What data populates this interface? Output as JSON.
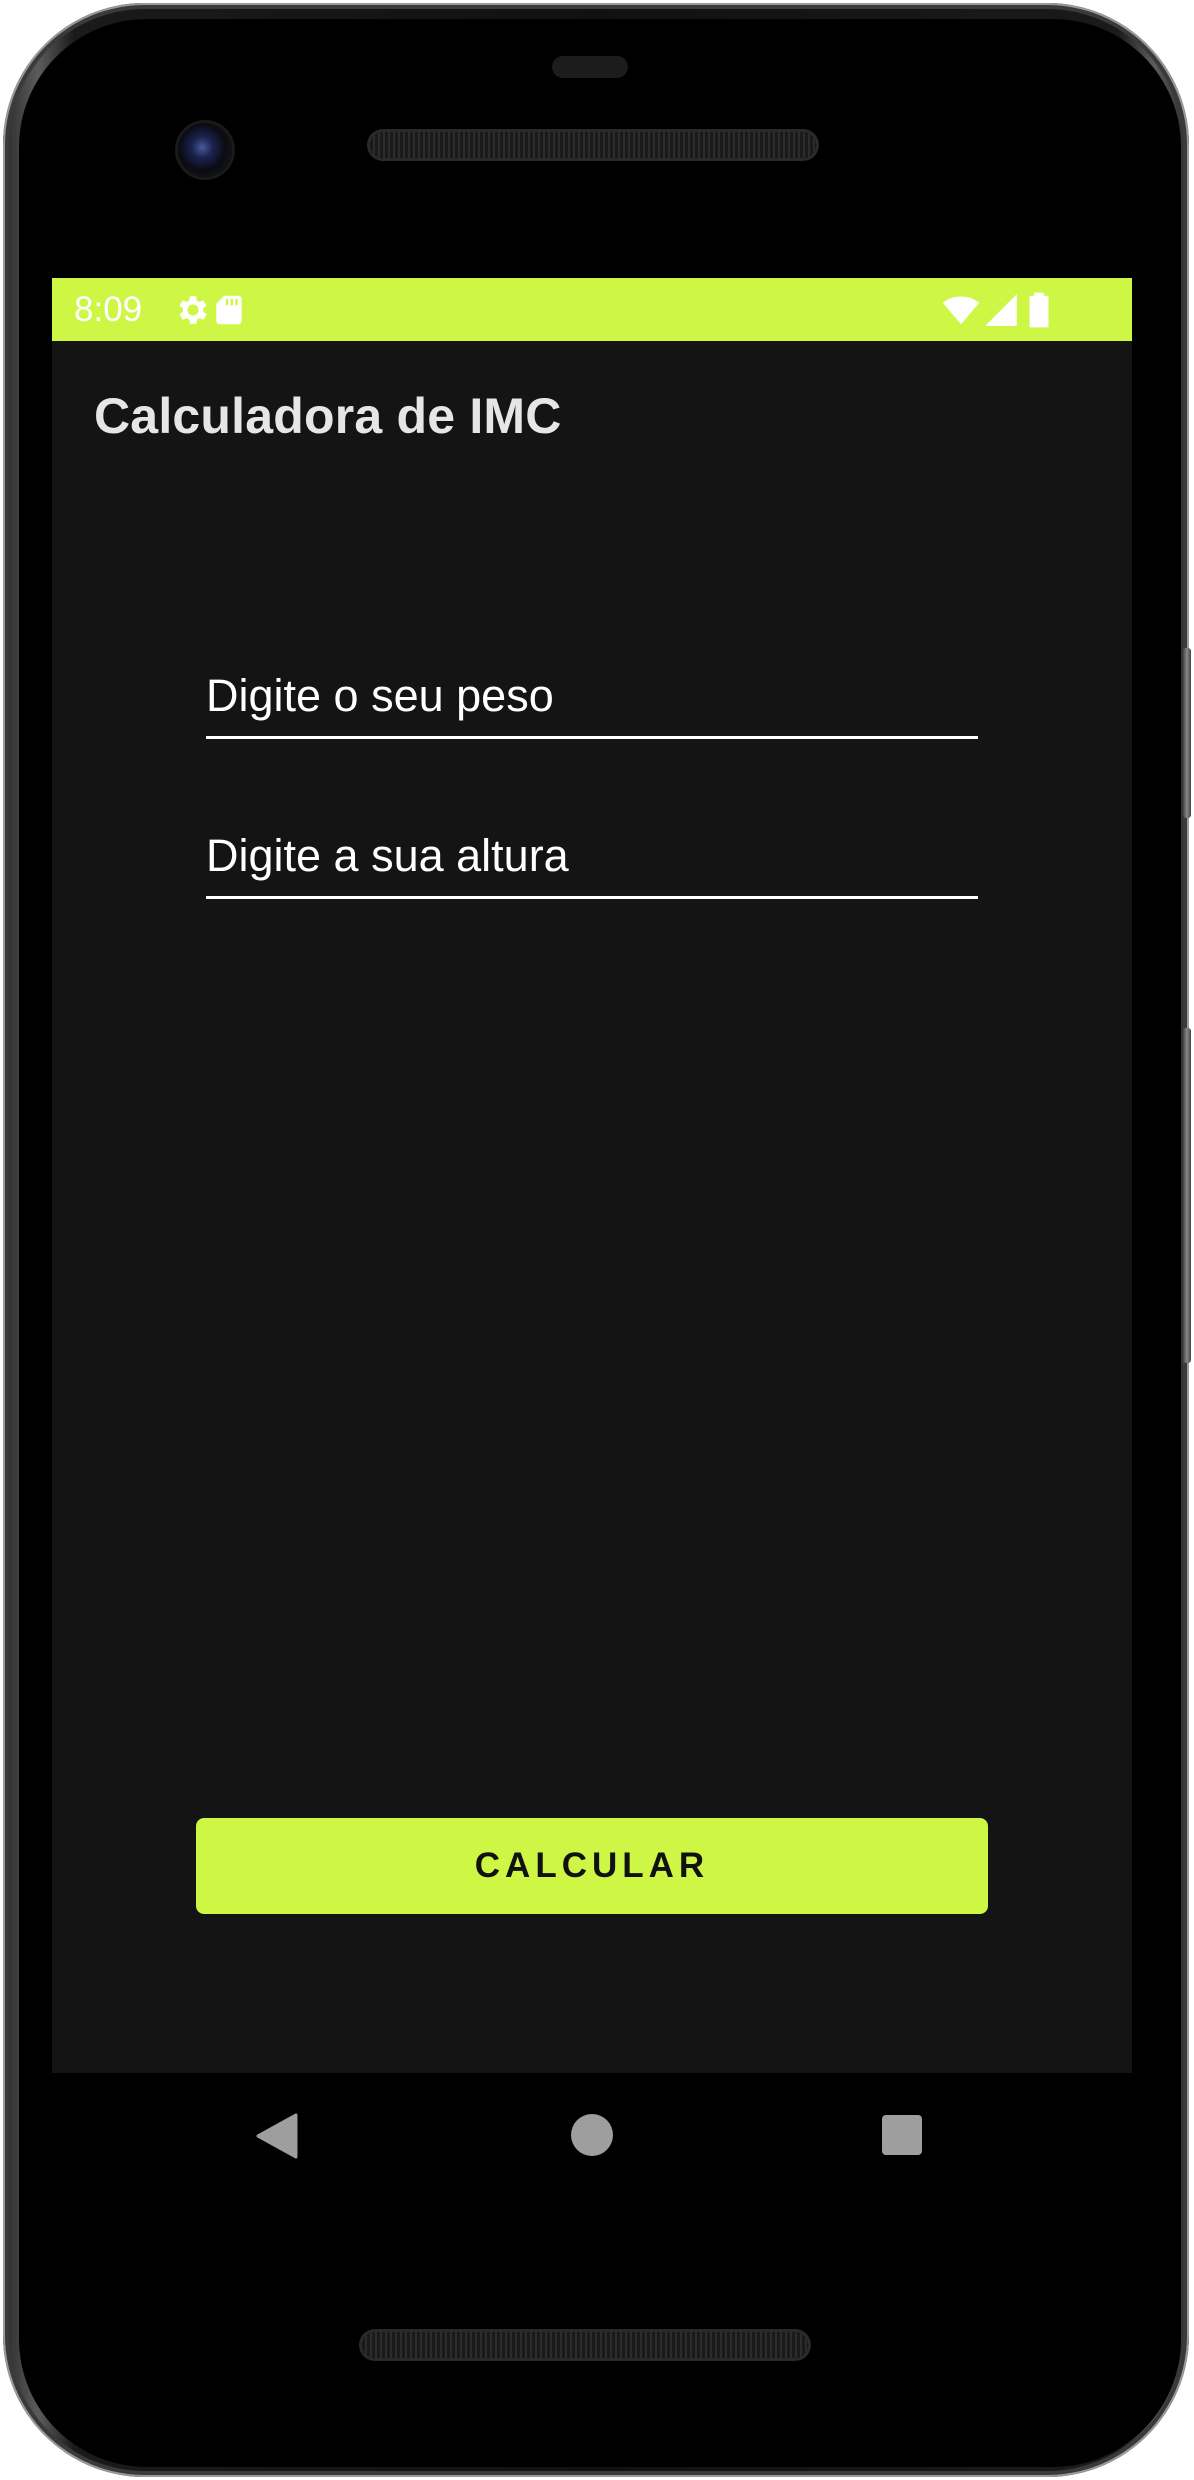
{
  "status_bar": {
    "time": "8:09",
    "background_color": "#cdf645",
    "left_icons": [
      "gear-icon",
      "sd-card-icon"
    ],
    "right_icons": [
      "wifi-icon",
      "cell-signal-icon",
      "battery-icon"
    ]
  },
  "app": {
    "title": "Calculadora de IMC"
  },
  "form": {
    "weight_placeholder": "Digite o seu peso",
    "weight_value": "",
    "height_placeholder": "Digite a sua altura",
    "height_value": ""
  },
  "actions": {
    "calculate_label": "CALCULAR",
    "accent_color": "#cdf645"
  },
  "nav_bar": {
    "buttons": [
      "back-icon",
      "home-icon",
      "recents-icon"
    ]
  }
}
